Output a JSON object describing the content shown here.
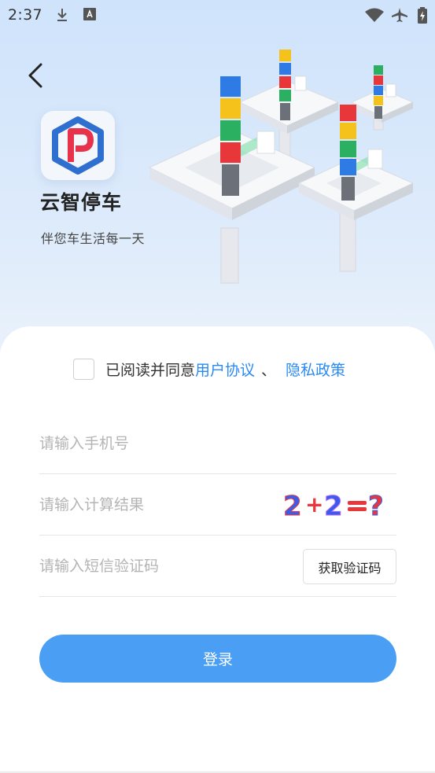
{
  "status_bar": {
    "time": "2:37",
    "icons": [
      "download-icon",
      "keyboard-icon",
      "wifi-icon",
      "airplane-icon",
      "battery-icon"
    ]
  },
  "header": {
    "app_name": "云智停车",
    "slogan": "伴您车生活每一天",
    "logo_letter": "P"
  },
  "agreement": {
    "prefix": "已阅读并同意",
    "user_agreement": "用户协议",
    "separator": "、",
    "privacy_policy": "隐私政策",
    "checked": false
  },
  "form": {
    "phone_placeholder": "请输入手机号",
    "phone_value": "",
    "calc_placeholder": "请输入计算结果",
    "calc_value": "",
    "captcha_text": "2+2=?",
    "sms_placeholder": "请输入短信验证码",
    "sms_value": "",
    "get_code_label": "获取验证码"
  },
  "login_button_label": "登录",
  "colors": {
    "accent": "#4a9ff5",
    "link": "#2a8af2",
    "logo_blue": "#2e6fd0",
    "logo_red": "#e8314a"
  }
}
